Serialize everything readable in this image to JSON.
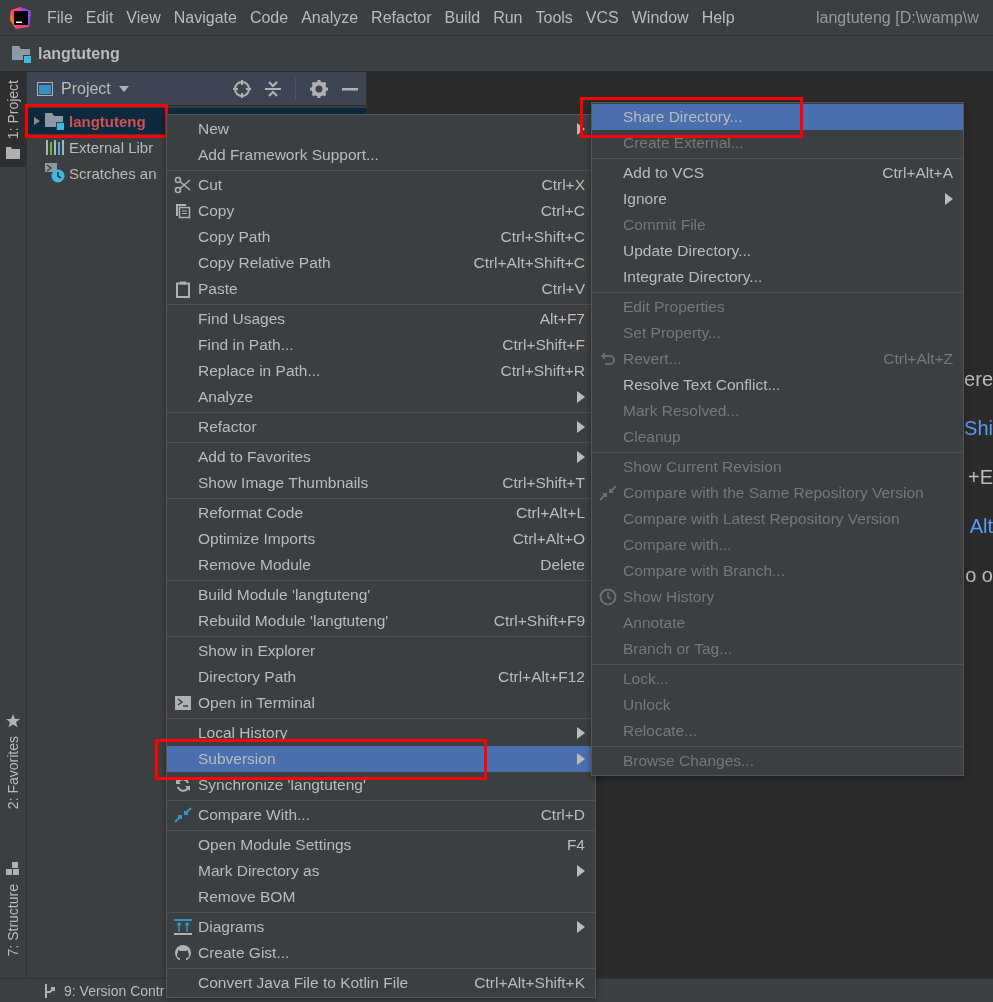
{
  "title_bar": {
    "menus": [
      "File",
      "Edit",
      "View",
      "Navigate",
      "Code",
      "Analyze",
      "Refactor",
      "Build",
      "Run",
      "Tools",
      "VCS",
      "Window",
      "Help"
    ],
    "title": "langtuteng [D:\\wamp\\w"
  },
  "nav_bar": {
    "project": "langtuteng"
  },
  "tool_strip": {
    "tabs": [
      {
        "label": "1: Project",
        "selected": true
      },
      {
        "label": "2: Favorites",
        "selected": false
      },
      {
        "label": "7: Structure",
        "selected": false
      }
    ]
  },
  "project_panel": {
    "title": "Project",
    "tree": [
      {
        "label": "langtuteng",
        "expanded": false,
        "selected": true,
        "outlined": true
      },
      {
        "label": "External Libr",
        "selected": false,
        "outlined": false
      },
      {
        "label": "Scratches an",
        "selected": false,
        "outlined": false
      }
    ]
  },
  "editor": {
    "fragments": [
      {
        "text": "ere",
        "kind": "plain"
      },
      {
        "text": "Shi",
        "kind": "shortcut"
      },
      {
        "text": "+E",
        "kind": "plain"
      },
      {
        "text": "Alt",
        "kind": "shortcut"
      },
      {
        "text": "o o",
        "kind": "plain"
      }
    ]
  },
  "context_menu": {
    "groups": [
      [
        {
          "label": "New",
          "submenu": true,
          "selected": false,
          "disabled": false
        },
        {
          "label": "Add Framework Support...",
          "submenu": false,
          "selected": false,
          "disabled": false
        }
      ],
      [
        {
          "label": "Cut",
          "shortcut": "Ctrl+X",
          "submenu": false,
          "selected": false,
          "disabled": false
        },
        {
          "label": "Copy",
          "shortcut": "Ctrl+C",
          "submenu": false,
          "selected": false,
          "disabled": false
        },
        {
          "label": "Copy Path",
          "shortcut": "Ctrl+Shift+C",
          "submenu": false,
          "selected": false,
          "disabled": false
        },
        {
          "label": "Copy Relative Path",
          "shortcut": "Ctrl+Alt+Shift+C",
          "submenu": false,
          "selected": false,
          "disabled": false
        },
        {
          "label": "Paste",
          "shortcut": "Ctrl+V",
          "submenu": false,
          "selected": false,
          "disabled": false
        }
      ],
      [
        {
          "label": "Find Usages",
          "shortcut": "Alt+F7",
          "submenu": false,
          "selected": false,
          "disabled": false
        },
        {
          "label": "Find in Path...",
          "shortcut": "Ctrl+Shift+F",
          "submenu": false,
          "selected": false,
          "disabled": false
        },
        {
          "label": "Replace in Path...",
          "shortcut": "Ctrl+Shift+R",
          "submenu": false,
          "selected": false,
          "disabled": false
        },
        {
          "label": "Analyze",
          "submenu": true,
          "selected": false,
          "disabled": false
        }
      ],
      [
        {
          "label": "Refactor",
          "submenu": true,
          "selected": false,
          "disabled": false
        }
      ],
      [
        {
          "label": "Add to Favorites",
          "submenu": true,
          "selected": false,
          "disabled": false
        },
        {
          "label": "Show Image Thumbnails",
          "shortcut": "Ctrl+Shift+T",
          "submenu": false,
          "selected": false,
          "disabled": false
        }
      ],
      [
        {
          "label": "Reformat Code",
          "shortcut": "Ctrl+Alt+L",
          "submenu": false,
          "selected": false,
          "disabled": false
        },
        {
          "label": "Optimize Imports",
          "shortcut": "Ctrl+Alt+O",
          "submenu": false,
          "selected": false,
          "disabled": false
        },
        {
          "label": "Remove Module",
          "shortcut": "Delete",
          "submenu": false,
          "selected": false,
          "disabled": false
        }
      ],
      [
        {
          "label": "Build Module 'langtuteng'",
          "submenu": false,
          "selected": false,
          "disabled": false
        },
        {
          "label": "Rebuild Module 'langtuteng'",
          "shortcut": "Ctrl+Shift+F9",
          "submenu": false,
          "selected": false,
          "disabled": false
        }
      ],
      [
        {
          "label": "Show in Explorer",
          "submenu": false,
          "selected": false,
          "disabled": false
        },
        {
          "label": "Directory Path",
          "shortcut": "Ctrl+Alt+F12",
          "submenu": false,
          "selected": false,
          "disabled": false
        },
        {
          "label": "Open in Terminal",
          "submenu": false,
          "selected": false,
          "disabled": false
        }
      ],
      [
        {
          "label": "Local History",
          "submenu": true,
          "selected": false,
          "disabled": false
        },
        {
          "label": "Subversion",
          "submenu": true,
          "selected": true,
          "disabled": false,
          "outlined": true
        },
        {
          "label": "Synchronize 'langtuteng'",
          "submenu": false,
          "selected": false,
          "disabled": false
        }
      ],
      [
        {
          "label": "Compare With...",
          "shortcut": "Ctrl+D",
          "submenu": false,
          "selected": false,
          "disabled": false
        }
      ],
      [
        {
          "label": "Open Module Settings",
          "shortcut": "F4",
          "submenu": false,
          "selected": false,
          "disabled": false
        },
        {
          "label": "Mark Directory as",
          "submenu": true,
          "selected": false,
          "disabled": false
        },
        {
          "label": "Remove BOM",
          "submenu": false,
          "selected": false,
          "disabled": false
        }
      ],
      [
        {
          "label": "Diagrams",
          "submenu": true,
          "selected": false,
          "disabled": false
        },
        {
          "label": "Create Gist...",
          "submenu": false,
          "selected": false,
          "disabled": false
        }
      ],
      [
        {
          "label": "Convert Java File to Kotlin File",
          "shortcut": "Ctrl+Alt+Shift+K",
          "submenu": false,
          "selected": false,
          "disabled": false
        }
      ]
    ]
  },
  "subversion_menu": {
    "groups": [
      [
        {
          "label": "Share Directory...",
          "submenu": false,
          "selected": true,
          "disabled": false,
          "outlined": true
        },
        {
          "label": "Create External...",
          "submenu": false,
          "selected": false,
          "disabled": true
        }
      ],
      [
        {
          "label": "Add to VCS",
          "shortcut": "Ctrl+Alt+A",
          "submenu": false,
          "selected": false,
          "disabled": false
        },
        {
          "label": "Ignore",
          "submenu": true,
          "selected": false,
          "disabled": false
        },
        {
          "label": "Commit File",
          "submenu": false,
          "selected": false,
          "disabled": true
        },
        {
          "label": "Update Directory...",
          "submenu": false,
          "selected": false,
          "disabled": false
        },
        {
          "label": "Integrate Directory...",
          "submenu": false,
          "selected": false,
          "disabled": false
        }
      ],
      [
        {
          "label": "Edit Properties",
          "submenu": false,
          "selected": false,
          "disabled": true
        },
        {
          "label": "Set Property...",
          "submenu": false,
          "selected": false,
          "disabled": true
        },
        {
          "label": "Revert...",
          "shortcut": "Ctrl+Alt+Z",
          "submenu": false,
          "selected": false,
          "disabled": true
        },
        {
          "label": "Resolve Text Conflict...",
          "submenu": false,
          "selected": false,
          "disabled": false
        },
        {
          "label": "Mark Resolved...",
          "submenu": false,
          "selected": false,
          "disabled": true
        },
        {
          "label": "Cleanup",
          "submenu": false,
          "selected": false,
          "disabled": true
        }
      ],
      [
        {
          "label": "Show Current Revision",
          "submenu": false,
          "selected": false,
          "disabled": true
        },
        {
          "label": "Compare with the Same Repository Version",
          "submenu": false,
          "selected": false,
          "disabled": true
        },
        {
          "label": "Compare with Latest Repository Version",
          "submenu": false,
          "selected": false,
          "disabled": true
        },
        {
          "label": "Compare with...",
          "submenu": false,
          "selected": false,
          "disabled": true
        },
        {
          "label": "Compare with Branch...",
          "submenu": false,
          "selected": false,
          "disabled": true
        },
        {
          "label": "Show History",
          "submenu": false,
          "selected": false,
          "disabled": true
        },
        {
          "label": "Annotate",
          "submenu": false,
          "selected": false,
          "disabled": true
        },
        {
          "label": "Branch or Tag...",
          "submenu": false,
          "selected": false,
          "disabled": true
        }
      ],
      [
        {
          "label": "Lock...",
          "submenu": false,
          "selected": false,
          "disabled": true
        },
        {
          "label": "Unlock",
          "submenu": false,
          "selected": false,
          "disabled": true
        },
        {
          "label": "Relocate...",
          "submenu": false,
          "selected": false,
          "disabled": true
        }
      ],
      [
        {
          "label": "Browse Changes...",
          "submenu": false,
          "selected": false,
          "disabled": true
        }
      ]
    ]
  },
  "status_bar": {
    "tool": "9: Version Contr"
  }
}
